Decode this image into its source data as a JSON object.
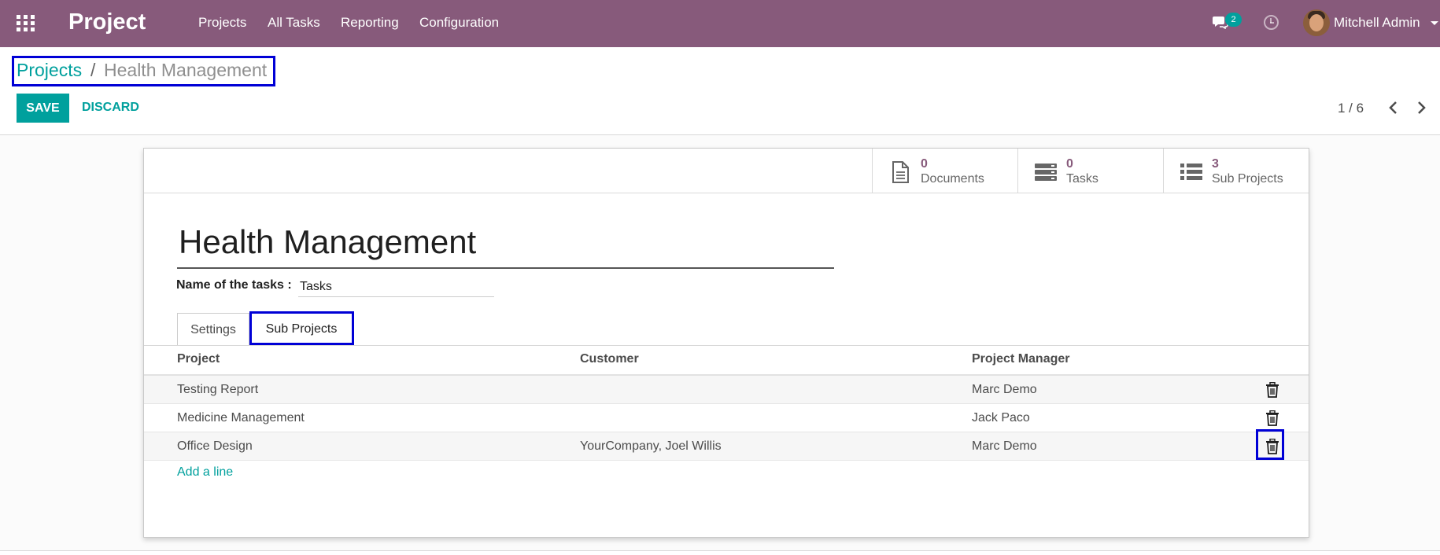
{
  "navbar": {
    "brand": "Project",
    "menu": [
      "Projects",
      "All Tasks",
      "Reporting",
      "Configuration"
    ],
    "chat_count": "2",
    "user_name": "Mitchell Admin",
    "color": "#875a7b"
  },
  "breadcrumb": {
    "parent": "Projects",
    "separator": "/",
    "current": "Health Management"
  },
  "actions": {
    "save": "SAVE",
    "discard": "DISCARD"
  },
  "pager": {
    "value": "1 / 6"
  },
  "stat_buttons": [
    {
      "value": "0",
      "label": "Documents",
      "icon": "document-icon"
    },
    {
      "value": "0",
      "label": "Tasks",
      "icon": "tasks-icon"
    },
    {
      "value": "3",
      "label": "Sub Projects",
      "icon": "list-icon"
    }
  ],
  "form": {
    "name": "Health Management",
    "tasks_label": "Name of the tasks :",
    "tasks_value": "Tasks"
  },
  "tabs": [
    {
      "label": "Settings"
    },
    {
      "label": "Sub Projects"
    }
  ],
  "table": {
    "columns": [
      "Project",
      "Customer",
      "Project Manager"
    ],
    "rows": [
      {
        "project": "Testing Report",
        "customer": "",
        "manager": "Marc Demo"
      },
      {
        "project": "Medicine Management",
        "customer": "",
        "manager": "Jack Paco"
      },
      {
        "project": "Office Design",
        "customer": "YourCompany, Joel Willis",
        "manager": "Marc Demo"
      }
    ],
    "add_line": "Add a line"
  },
  "colors": {
    "accent": "#00a09d",
    "highlight_box": "#0000d6"
  }
}
